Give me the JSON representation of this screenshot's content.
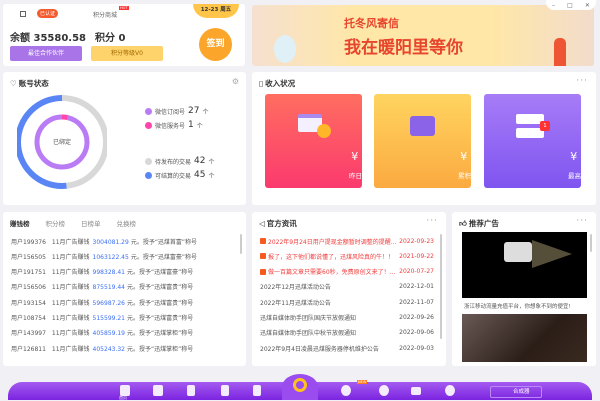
{
  "window": {
    "controls": [
      "minimize",
      "maximize",
      "close"
    ]
  },
  "profile": {
    "verified": "已认证",
    "points_mall": "积分商城",
    "hot_badge": "HOT",
    "balance_label": "余额",
    "balance": "35580.58",
    "points_label": "积分",
    "points": "0",
    "partner_btn": "最佳合作伙伴",
    "level_btn": "积分等级V0",
    "date": "12-23 周五",
    "signin": "签到"
  },
  "banner": {
    "line1": "托冬风寄信",
    "line2": "我在暖阳里等你"
  },
  "account": {
    "title": "账号状态",
    "center": "已绑定",
    "legend": [
      {
        "label": "微信订阅号",
        "value": "27",
        "unit": "个",
        "color": "#b97cf5"
      },
      {
        "label": "微信服务号",
        "value": "1",
        "unit": "个",
        "color": "#ff44aa"
      },
      {
        "label": "待发布的交易",
        "value": "42",
        "unit": "个",
        "color": "#d8d8d8"
      },
      {
        "label": "可结算的交易",
        "value": "45",
        "unit": "个",
        "color": "#5a86f5"
      }
    ]
  },
  "income": {
    "title": "收入状况",
    "tiles": [
      {
        "amount": "¥ **",
        "label": "昨日收入"
      },
      {
        "amount": "¥ **",
        "label": "累积收入"
      },
      {
        "amount": "¥ **",
        "label": "最高纪录",
        "badge": "1"
      }
    ]
  },
  "ranking": {
    "tabs": [
      "赚钱榜",
      "积分榜",
      "日榜单",
      "兑换榜"
    ],
    "rows": [
      {
        "user": "用户199376",
        "desc": "11月广告赚钱",
        "amount": "3004081.29",
        "suffix": "元。授予“迅煤首富”称号"
      },
      {
        "user": "用户156505",
        "desc": "11月广告赚钱",
        "amount": "1063122.45",
        "suffix": "元。授予“迅煤富豪”称号"
      },
      {
        "user": "用户191751",
        "desc": "11月广告赚钱",
        "amount": "998328.41",
        "suffix": "元。授予“迅煤富豪”称号"
      },
      {
        "user": "用户156506",
        "desc": "11月广告赚钱",
        "amount": "875519.44",
        "suffix": "元。授予“迅煤富贵”称号"
      },
      {
        "user": "用户193154",
        "desc": "11月广告赚钱",
        "amount": "596987.26",
        "suffix": "元。授予“迅煤富贵”称号"
      },
      {
        "user": "用户108754",
        "desc": "11月广告赚钱",
        "amount": "515599.21",
        "suffix": "元。授予“迅煤富贵”称号"
      },
      {
        "user": "用户143997",
        "desc": "11月广告赚钱",
        "amount": "405859.19",
        "suffix": "元。授予“迅煤掌柜”称号"
      },
      {
        "user": "用户126811",
        "desc": "11月广告赚钱",
        "amount": "405243.32",
        "suffix": "元。授予“迅煤掌柜”称号"
      }
    ]
  },
  "news": {
    "title": "官方资讯",
    "items": [
      {
        "text": "2022年9月24日用户提现金额暂时调整的提醒公告",
        "date": "2022-09-23",
        "pinned": true
      },
      {
        "text": "报了，这下他们都说懂了，迅煤风险真的牛！！",
        "date": "2021-09-22",
        "pinned": true
      },
      {
        "text": "做一百篇文章只需要60秒，免费原创文来了！迅...",
        "date": "2020-07-27",
        "pinned": true
      },
      {
        "text": "2022年12月迅煤活动公告",
        "date": "2022-12-01",
        "pinned": false
      },
      {
        "text": "2022年11月迅煤活动公告",
        "date": "2022-11-07",
        "pinned": false
      },
      {
        "text": "迅煤自媒体助手团队国庆节放假通知",
        "date": "2022-09-26",
        "pinned": false
      },
      {
        "text": "迅煤自媒体助手团队中秋节放假通知",
        "date": "2022-09-06",
        "pinned": false
      },
      {
        "text": "2022年9月4日凌晨迅煤服务器停机维护公告",
        "date": "2022-09-03",
        "pinned": false
      }
    ]
  },
  "ads": {
    "title": "推荐广告",
    "caption": "浙江移动流量充值平台，你想象不到的便宜!"
  },
  "bottom": {
    "home": "首页",
    "new_badge": "NEW",
    "synth": "合成器"
  }
}
